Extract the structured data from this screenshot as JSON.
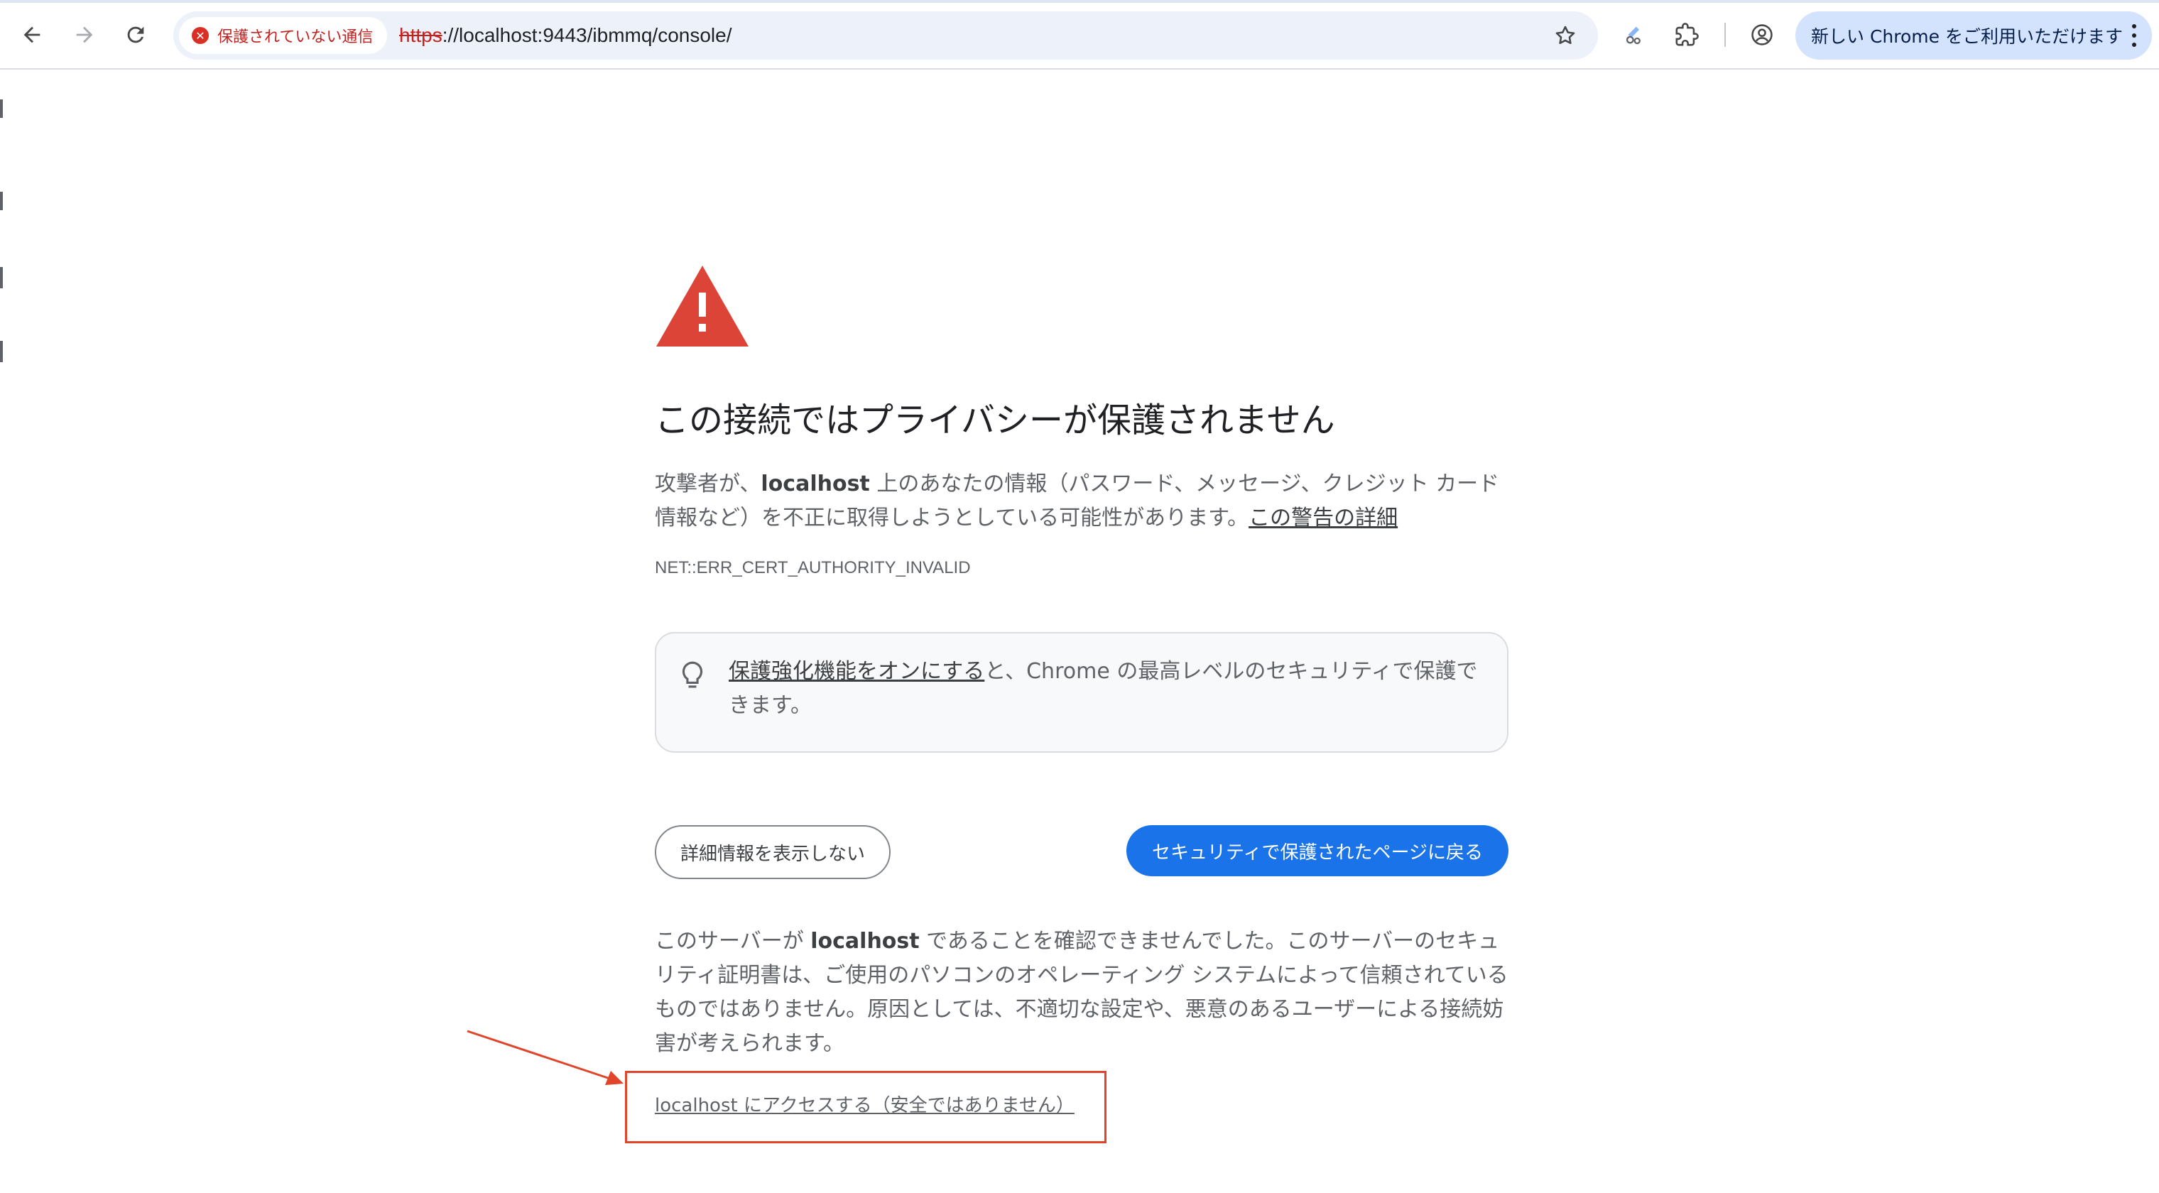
{
  "browser": {
    "nav": {
      "back_icon": "arrow-back-icon",
      "forward_icon": "arrow-forward-icon",
      "reload_icon": "reload-icon"
    },
    "security_chip": {
      "label": "保護されていない通信",
      "icon": "error-circle-icon",
      "color": "#c5221f"
    },
    "url": {
      "scheme": "https",
      "rest": "://localhost:9443/ibmmq/console/"
    },
    "bookmark_icon": "star-icon",
    "extensions": [
      "color-picker-extension-icon",
      "puzzle-extensions-icon"
    ],
    "profile_icon": "profile-icon",
    "update_pill": {
      "label": "新しい Chrome をご利用いただけます",
      "menu_icon": "more-vert-icon"
    }
  },
  "interstitial": {
    "warning_icon": "warning-triangle-icon",
    "warning_color": "#db4437",
    "heading": "この接続ではプライバシーが保護されません",
    "intro": {
      "prefix": "攻撃者が、",
      "host": "localhost",
      "suffix": " 上のあなたの情報（パスワード、メッセージ、クレジット カード情報など）を不正に取得しようとしている可能性があります。",
      "learn_more": "この警告の詳細"
    },
    "error_code": "NET::ERR_CERT_AUTHORITY_INVALID",
    "enhanced_protection": {
      "icon": "lightbulb-icon",
      "link": "保護強化機能をオンにする",
      "text": "と、Chrome の最高レベルのセキュリティで保護できます。"
    },
    "hide_details_button": "詳細情報を表示しない",
    "back_to_safety_button": "セキュリティで保護されたページに戻る",
    "details": {
      "prefix": "このサーバーが ",
      "host": "localhost",
      "suffix": " であることを確認できませんでした。このサーバーのセキュリティ証明書は、ご使用のパソコンのオペレーティング システムによって信頼されているものではありません。原因としては、不適切な設定や、悪意のあるユーザーによる接続妨害が考えられます。"
    },
    "proceed_link": "localhost にアクセスする（安全ではありません）",
    "accent_color": "#1a73e8"
  },
  "annotation": {
    "color": "#e0442b",
    "arrow_icon": "annotation-arrow-icon"
  }
}
